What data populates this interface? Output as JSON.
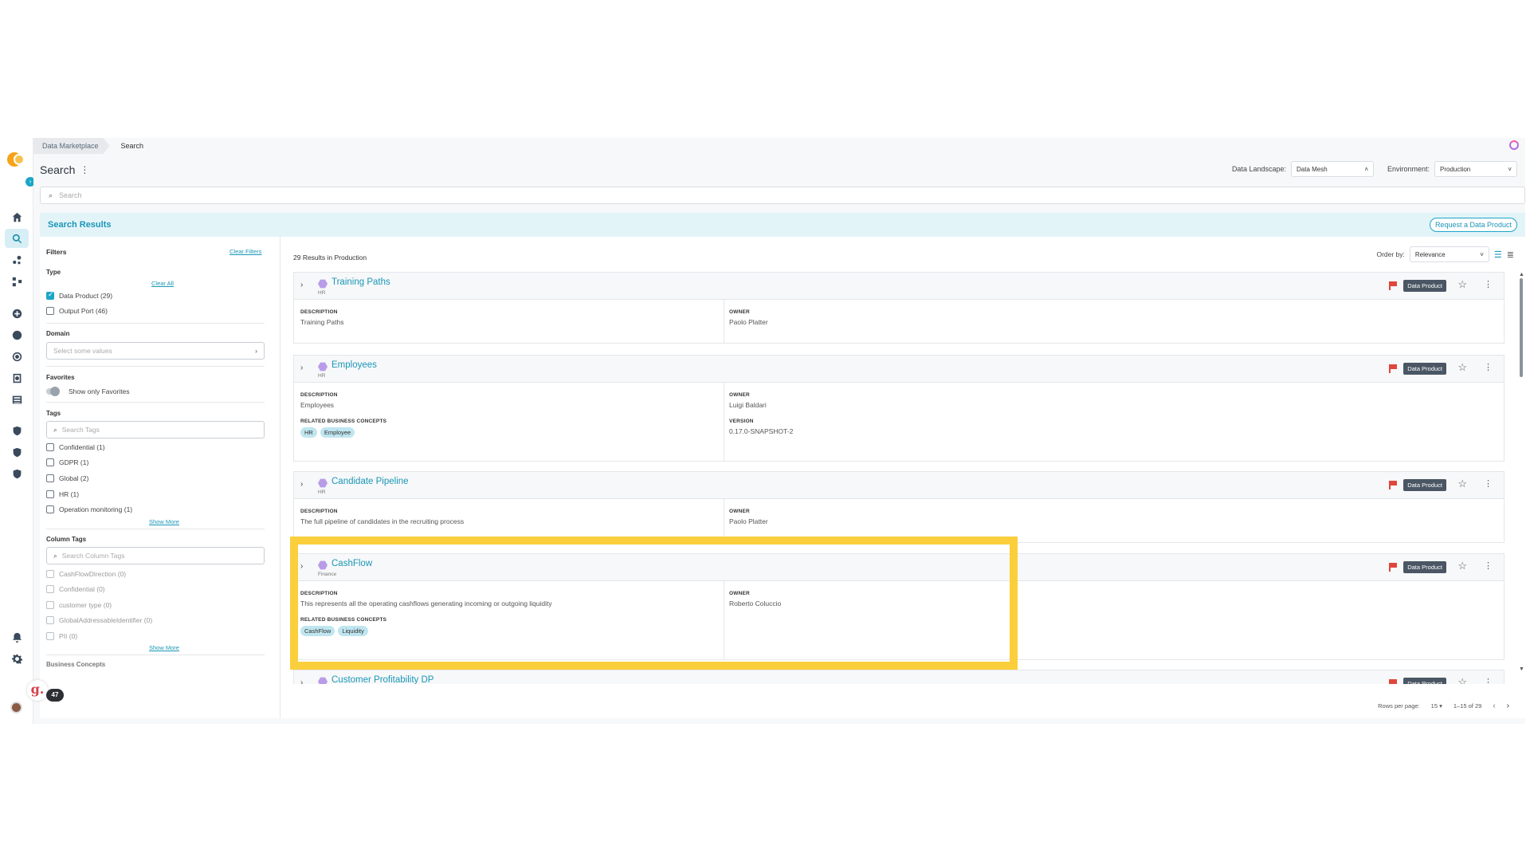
{
  "breadcrumbs": [
    "Data Marketplace",
    "Search"
  ],
  "page": {
    "title": "Search"
  },
  "data_landscape": {
    "label": "Data Landscape:",
    "value": "Data Mesh"
  },
  "environment": {
    "label": "Environment:",
    "value": "Production"
  },
  "search": {
    "placeholder": "Search"
  },
  "results_header": {
    "title": "Search Results",
    "request_button": "Request a Data Product"
  },
  "filters": {
    "title": "Filters",
    "clear_filters": "Clear Filters",
    "type": {
      "label": "Type",
      "clear_all": "Clear All",
      "options": [
        {
          "label": "Data Product (29)",
          "checked": true
        },
        {
          "label": "Output Port (46)",
          "checked": false
        }
      ]
    },
    "domain": {
      "label": "Domain",
      "placeholder": "Select some values"
    },
    "favorites": {
      "label": "Favorites",
      "toggle_label": "Show only Favorites"
    },
    "tags": {
      "label": "Tags",
      "placeholder": "Search Tags",
      "options": [
        "Confidential (1)",
        "GDPR (1)",
        "Global (2)",
        "HR (1)",
        "Operation monitoring (1)"
      ],
      "show_more": "Show More"
    },
    "column_tags": {
      "label": "Column Tags",
      "placeholder": "Search Column Tags",
      "options": [
        "CashFlowDirection (0)",
        "Confidential (0)",
        "customer type (0)",
        "GlobalAddressableIdentifier (0)",
        "PII (0)"
      ],
      "show_more": "Show More"
    },
    "next_section_label": "Business Concepts"
  },
  "results": {
    "count_text": "29 Results in Production",
    "order_by": {
      "label": "Order by:",
      "value": "Relevance"
    },
    "badge_label": "Data Product",
    "labels": {
      "description": "DESCRIPTION",
      "owner": "OWNER",
      "related": "RELATED BUSINESS CONCEPTS",
      "version": "VERSION"
    },
    "items": [
      {
        "name": "Training Paths",
        "domain": "HR",
        "description": "Training Paths",
        "owner": "Paolo Platter"
      },
      {
        "name": "Employees",
        "domain": "HR",
        "description": "Employees",
        "owner": "Luigi Baldari",
        "concepts": [
          "HR",
          "Employee"
        ],
        "version": "0.17.0-SNAPSHOT-2"
      },
      {
        "name": "Candidate Pipeline",
        "domain": "HR",
        "description": "The full pipeline of candidates in the recruiting process",
        "owner": "Paolo Platter"
      },
      {
        "name": "CashFlow",
        "domain": "Finance",
        "description": "This represents all the operating cashflows generating incoming or outgoing liquidity",
        "owner": "Roberto Coluccio",
        "concepts": [
          "CashFlow",
          "Liquidity"
        ]
      },
      {
        "name": "Customer Profitability DP",
        "domain": ""
      }
    ]
  },
  "pagination": {
    "rows_label": "Rows per page:",
    "rows_value": "15",
    "range": "1–15 of 29"
  },
  "grammarly": {
    "count": "47"
  },
  "colors": {
    "accent": "#1aa6c8",
    "highlight": "#fbcf3c",
    "flag": "#e0463c"
  }
}
